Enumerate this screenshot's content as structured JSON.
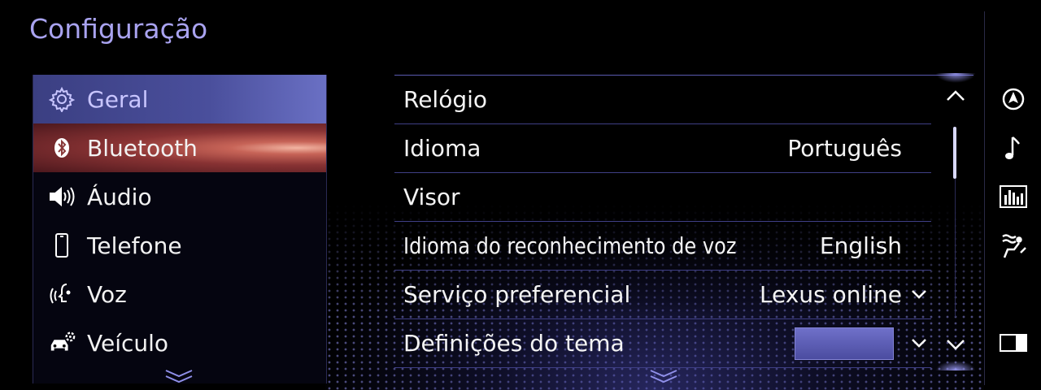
{
  "header": {
    "title": "Configuração"
  },
  "menu": {
    "items": [
      {
        "label": "Geral",
        "icon": "gear-icon"
      },
      {
        "label": "Bluetooth",
        "icon": "bluetooth-icon"
      },
      {
        "label": "Áudio",
        "icon": "speaker-icon"
      },
      {
        "label": "Telefone",
        "icon": "phone-icon"
      },
      {
        "label": "Voz",
        "icon": "voice-icon"
      },
      {
        "label": "Veículo",
        "icon": "vehicle-settings-icon"
      }
    ],
    "selected": "Geral",
    "focused": "Bluetooth"
  },
  "settings": {
    "rows": [
      {
        "label": "Relógio",
        "value": ""
      },
      {
        "label": "Idioma",
        "value": "Português"
      },
      {
        "label": "Visor",
        "value": ""
      },
      {
        "label": "Idioma do reconhecimento de voz",
        "value": "English"
      },
      {
        "label": "Serviço preferencial",
        "value": "Lexus online"
      },
      {
        "label": "Definições do tema",
        "value": ""
      }
    ],
    "scroll_fraction": 0.0
  },
  "sidebar": {
    "icons": [
      "navigation-icon",
      "music-note-icon",
      "equalizer-icon",
      "climate-icon",
      "split-screen-icon"
    ]
  },
  "colors": {
    "title": "#a9a3f0",
    "selected": "#4a4f9c",
    "focus": "#dc6e5f",
    "theme_swatch": "#5d5eb6"
  }
}
